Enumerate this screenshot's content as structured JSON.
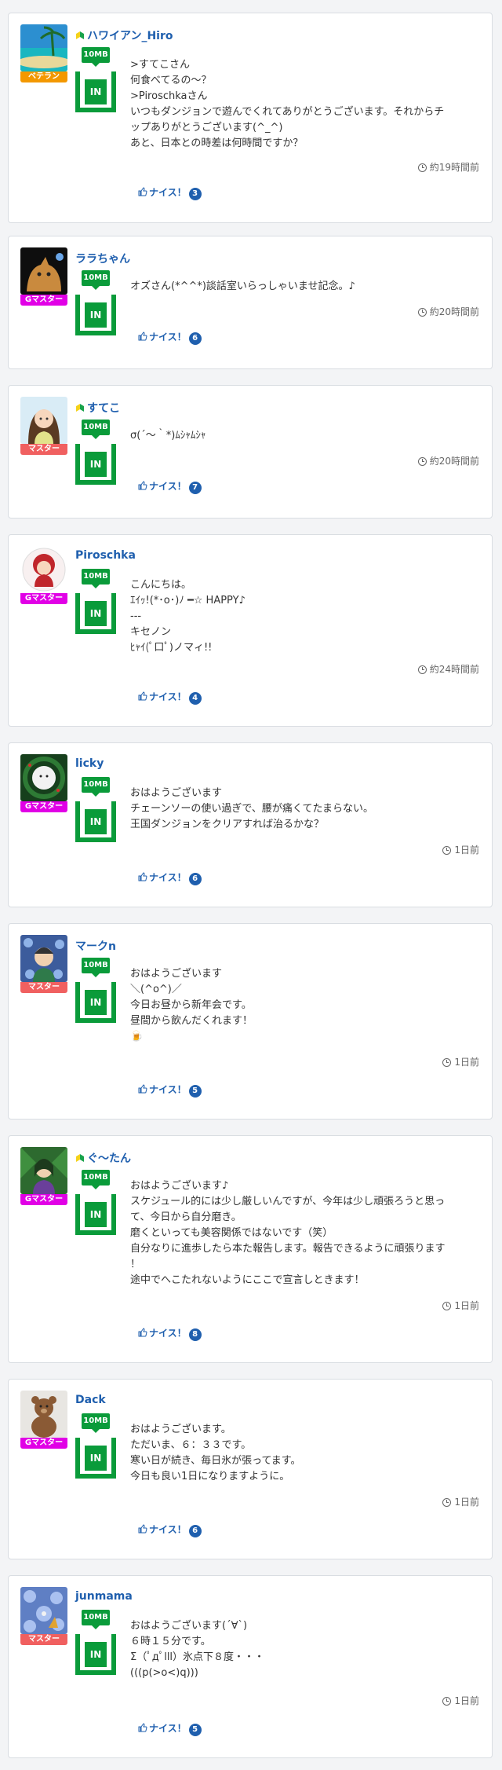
{
  "colors": {
    "accent_green": "#0a9b3a",
    "link_blue": "#1f5fae",
    "rank_veteran": "#f39800",
    "rank_gmaster": "#e100e6",
    "rank_master": "#f06060"
  },
  "posts": [
    {
      "name": "ハワイアン_Hiro",
      "beginner_mark": true,
      "rank": "ベテラン",
      "rank_color": "#f39800",
      "mb": "10MB",
      "in": "IN",
      "lines": [
        ">すてこさん",
        "何食べてるの〜？",
        ">Piroschkaさん",
        "いつもダンジョンで遊んでくれてありがとうございます。それからチ",
        "ップありがとうございます(^_^)",
        "あと、日本との時差は何時間ですか？"
      ],
      "time": "約19時間前",
      "nice_label": "ナイス！",
      "nice_count": "3"
    },
    {
      "name": "ララちゃん",
      "beginner_mark": false,
      "rank": "Gマスター",
      "rank_color": "#e100e6",
      "mb": "10MB",
      "in": "IN",
      "lines": [
        "オズさん(*^^*)談話室いらっしゃいませ記念。♪"
      ],
      "time": "約20時間前",
      "nice_label": "ナイス！",
      "nice_count": "6"
    },
    {
      "name": "すてこ",
      "beginner_mark": true,
      "rank": "マスター",
      "rank_color": "#f06060",
      "mb": "10MB",
      "in": "IN",
      "lines": [
        "σ(´～｀*)ﾑｼｬﾑｼｬ"
      ],
      "time": "約20時間前",
      "nice_label": "ナイス！",
      "nice_count": "7"
    },
    {
      "name": "Piroschka",
      "beginner_mark": false,
      "rank": "Gマスター",
      "rank_color": "#e100e6",
      "mb": "10MB",
      "in": "IN",
      "lines": [
        "こんにちは。",
        "ｴｲｯ!(*･o･)ﾉ ━☆ HAPPY♪",
        "---",
        "キセノン",
        "ﾋｬｲ(ﾟ口ﾟ)ノマィ!!"
      ],
      "time": "約24時間前",
      "nice_label": "ナイス！",
      "nice_count": "4"
    },
    {
      "name": "licky",
      "beginner_mark": false,
      "rank": "Gマスター",
      "rank_color": "#e100e6",
      "mb": "10MB",
      "in": "IN",
      "lines": [
        "おはようございます",
        "チェーンソーの使い過ぎで、腰が痛くてたまらない。",
        "王国ダンジョンをクリアすれば治るかな？"
      ],
      "time": "1日前",
      "nice_label": "ナイス！",
      "nice_count": "6"
    },
    {
      "name": "マークn",
      "beginner_mark": false,
      "rank": "マスター",
      "rank_color": "#f06060",
      "mb": "10MB",
      "in": "IN",
      "lines": [
        "おはようございます",
        "＼(^o^)／",
        "今日お昼から新年会です。",
        "昼間から飲んだくれます！",
        "🍺"
      ],
      "time": "1日前",
      "nice_label": "ナイス！",
      "nice_count": "5"
    },
    {
      "name": "ぐ〜たん",
      "beginner_mark": true,
      "rank": "Gマスター",
      "rank_color": "#e100e6",
      "mb": "10MB",
      "in": "IN",
      "lines": [
        "おはようございます♪",
        "スケジュール的には少し厳しいんですが、今年は少し頑張ろうと思っ",
        "て、今日から自分磨き。",
        "磨くといっても美容関係ではないです（笑）",
        "自分なりに進歩したら本た報告します。報告できるように頑張ります",
        "！",
        "途中でへこたれないようにここで宣言しときます！"
      ],
      "time": "1日前",
      "nice_label": "ナイス！",
      "nice_count": "8"
    },
    {
      "name": "Dack",
      "beginner_mark": false,
      "rank": "Gマスター",
      "rank_color": "#e100e6",
      "mb": "10MB",
      "in": "IN",
      "lines": [
        "おはようございます。",
        "ただいま、６：３３です。",
        "寒い日が続き、毎日氷が張ってます。",
        "今日も良い1日になりますように。"
      ],
      "time": "1日前",
      "nice_label": "ナイス！",
      "nice_count": "6"
    },
    {
      "name": "junmama",
      "beginner_mark": false,
      "rank": "マスター",
      "rank_color": "#f06060",
      "mb": "10MB",
      "in": "IN",
      "lines": [
        "おはようございます(´∀`)",
        "６時１５分です。",
        "Σ（ﾟдﾟlll）氷点下８度・・・",
        "(((p(>o<)q)))"
      ],
      "time": "1日前",
      "nice_label": "ナイス！",
      "nice_count": "5"
    }
  ]
}
